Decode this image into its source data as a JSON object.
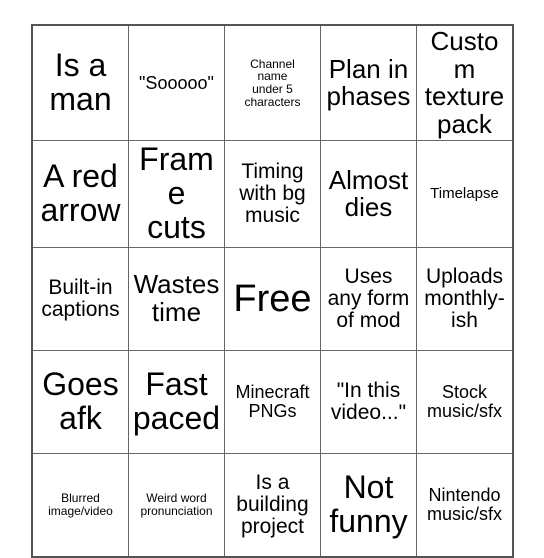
{
  "card": {
    "columns": 5,
    "rows": 5,
    "background_color": "#ffffff",
    "border_color": "#666666",
    "text_color": "#000000",
    "cells": [
      {
        "text": "Is a\nman",
        "size": "fs-xl"
      },
      {
        "text": "\"Sooooo\"",
        "size": "fs-sm"
      },
      {
        "text": "Channel\nname\nunder 5\ncharacters",
        "size": "fs-xxs"
      },
      {
        "text": "Plan in\nphases",
        "size": "fs-lg"
      },
      {
        "text": "Custom\ntexture\npack",
        "size": "fs-lg"
      },
      {
        "text": "A red\narrow",
        "size": "fs-xl"
      },
      {
        "text": "Frame\ncuts",
        "size": "fs-xl"
      },
      {
        "text": "Timing\nwith bg\nmusic",
        "size": "fs-md"
      },
      {
        "text": "Almost\ndies",
        "size": "fs-lg"
      },
      {
        "text": "Timelapse",
        "size": "fs-xs"
      },
      {
        "text": "Built-in\ncaptions",
        "size": "fs-md"
      },
      {
        "text": "Wastes\ntime",
        "size": "fs-lg"
      },
      {
        "text": "Free",
        "size": "fs-xxl"
      },
      {
        "text": "Uses\nany form\nof mod",
        "size": "fs-md"
      },
      {
        "text": "Uploads\nmonthly-\nish",
        "size": "fs-md"
      },
      {
        "text": "Goes\nafk",
        "size": "fs-xl"
      },
      {
        "text": "Fast\npaced",
        "size": "fs-xl"
      },
      {
        "text": "Minecraft\nPNGs",
        "size": "fs-sm"
      },
      {
        "text": "\"In this\nvideo...\"",
        "size": "fs-md"
      },
      {
        "text": "Stock\nmusic/sfx",
        "size": "fs-sm"
      },
      {
        "text": "Blurred\nimage/video",
        "size": "fs-xxs"
      },
      {
        "text": "Weird word\npronunciation",
        "size": "fs-xxs"
      },
      {
        "text": "Is a\nbuilding\nproject",
        "size": "fs-md"
      },
      {
        "text": "Not\nfunny",
        "size": "fs-xl"
      },
      {
        "text": "Nintendo\nmusic/sfx",
        "size": "fs-sm"
      }
    ]
  }
}
